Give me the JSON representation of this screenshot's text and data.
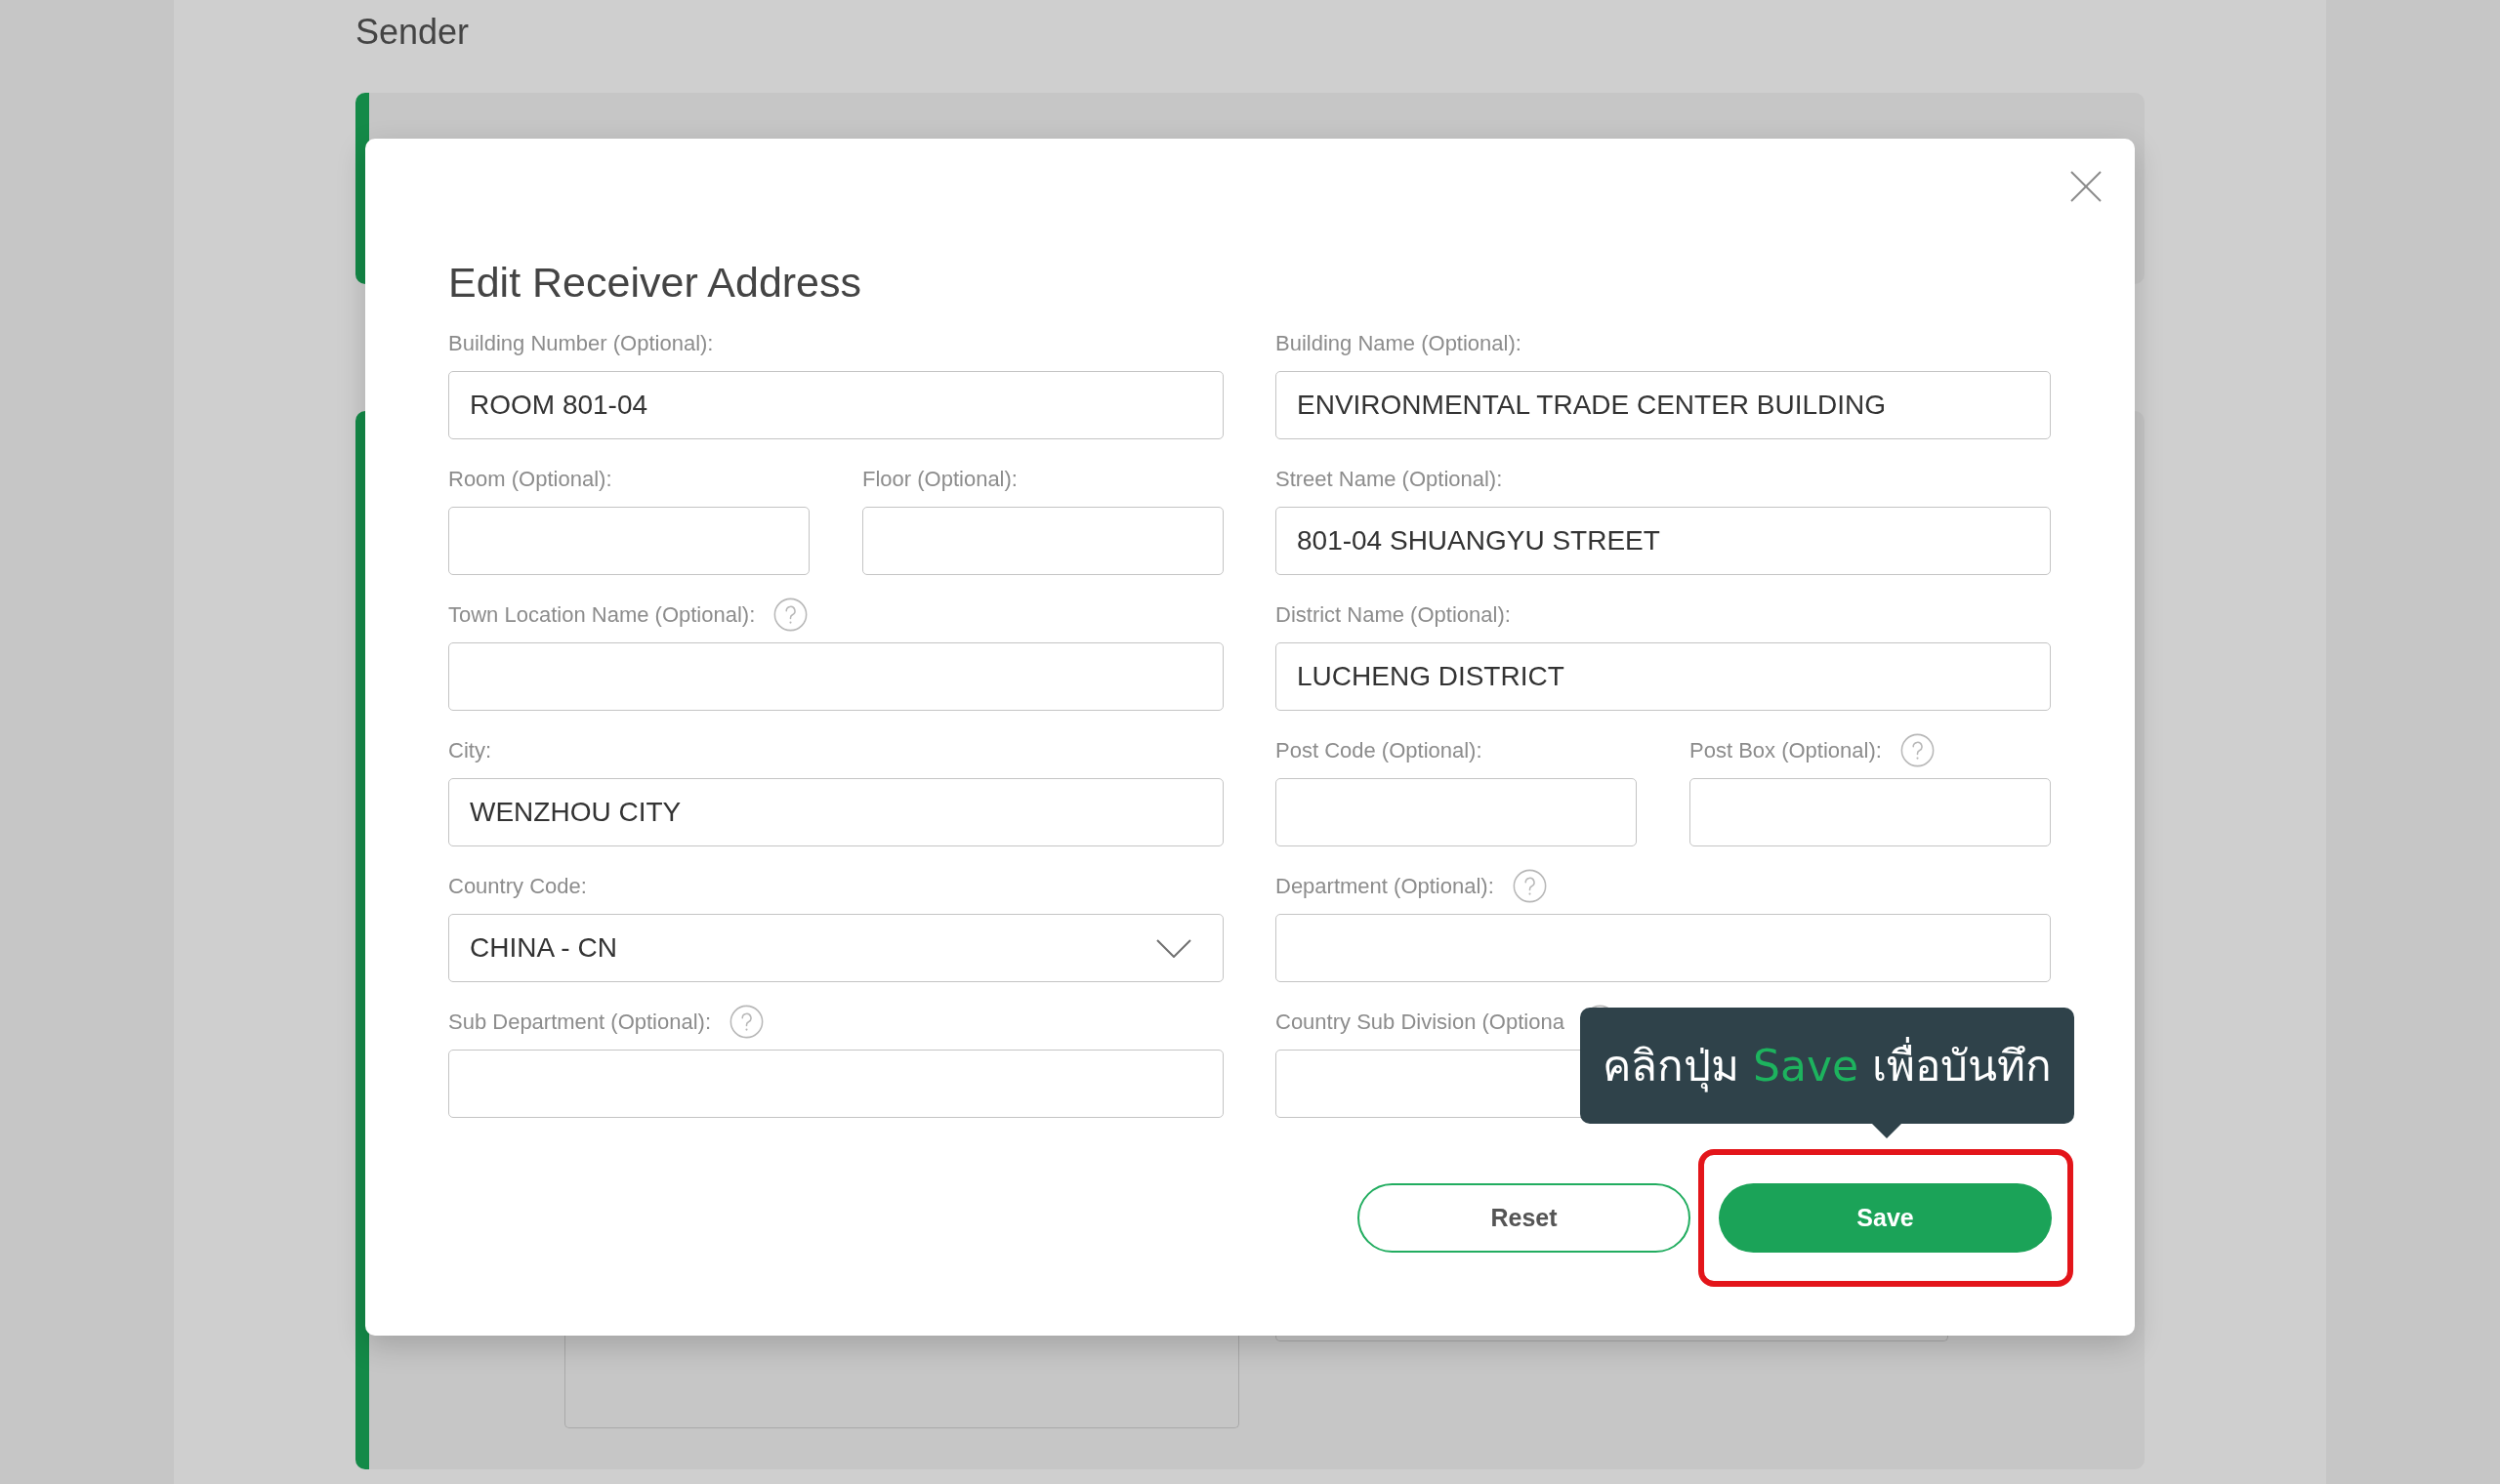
{
  "page": {
    "heading": "Sender"
  },
  "modal": {
    "title": "Edit Receiver Address",
    "columns": [
      [
        {
          "fields": [
            {
              "label": "Building Number (Optional):",
              "kind": "text",
              "value": "ROOM 801-04",
              "help": false
            }
          ]
        },
        {
          "fields": [
            {
              "label": "Room (Optional):",
              "kind": "text",
              "help": false
            },
            {
              "label": "Floor (Optional):",
              "kind": "text",
              "help": false
            }
          ]
        },
        {
          "fields": [
            {
              "label": "Town Location Name (Optional):",
              "kind": "text",
              "help": true
            }
          ]
        },
        {
          "fields": [
            {
              "label": "City:",
              "kind": "text",
              "value": "WENZHOU CITY",
              "help": false
            }
          ]
        },
        {
          "fields": [
            {
              "label": "Country Code:",
              "kind": "select",
              "value": "CHINA - CN",
              "help": false
            }
          ]
        },
        {
          "fields": [
            {
              "label": "Sub Department (Optional):",
              "kind": "text",
              "help": true
            }
          ]
        }
      ],
      [
        {
          "fields": [
            {
              "label": "Building Name (Optional):",
              "kind": "text",
              "value": "ENVIRONMENTAL TRADE CENTER BUILDING",
              "help": false
            }
          ]
        },
        {
          "fields": [
            {
              "label": "Street Name (Optional):",
              "kind": "text",
              "value": "801-04 SHUANGYU STREET",
              "help": false
            }
          ]
        },
        {
          "fields": [
            {
              "label": "District Name (Optional):",
              "kind": "text",
              "value": "LUCHENG DISTRICT",
              "help": false
            }
          ]
        },
        {
          "fields": [
            {
              "label": "Post Code (Optional):",
              "kind": "text",
              "help": false
            },
            {
              "label": "Post Box (Optional):",
              "kind": "text",
              "help": true
            }
          ]
        },
        {
          "fields": [
            {
              "label": "Department (Optional):",
              "kind": "text",
              "help": true
            }
          ]
        },
        {
          "fields": [
            {
              "label": "Country Sub Division (Optiona",
              "kind": "text",
              "help": true
            }
          ]
        }
      ]
    ],
    "tooltip": {
      "segments": [
        {
          "text": "คลิกปุ่ม",
          "highlight": false
        },
        {
          "text": "Save",
          "highlight": true
        },
        {
          "text": "เพื่อบันทึก",
          "highlight": false
        }
      ]
    },
    "buttons": [
      {
        "label": "Reset",
        "kind": "outline",
        "highlighted": false
      },
      {
        "label": "Save",
        "kind": "filled",
        "highlighted": true
      }
    ]
  }
}
